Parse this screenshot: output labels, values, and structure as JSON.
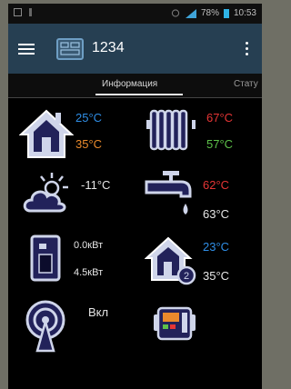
{
  "status_bar": {
    "battery": "78%",
    "time": "10:53"
  },
  "app_bar": {
    "title": "1234"
  },
  "tabs": [
    {
      "label": "Информация"
    },
    {
      "label": "Стату"
    }
  ],
  "tiles": {
    "home": {
      "temp_top": "25°C",
      "temp_bottom": "35°C"
    },
    "radiator": {
      "temp_top": "67°C",
      "temp_bottom": "57°C"
    },
    "weather": {
      "value": "-11°C"
    },
    "tap": {
      "temp_top": "62°C",
      "temp_bottom": "63°C"
    },
    "power": {
      "value_top": "0.0кВт",
      "value_bottom": "4.5кВт"
    },
    "home2": {
      "temp_top": "23°C",
      "temp_bottom": "35°C"
    },
    "antenna": {
      "value": "Вкл"
    }
  },
  "colors": {
    "blue": "#2f8ee6",
    "orange": "#e98a2c",
    "red": "#e53535",
    "green": "#5dc14a",
    "appbar": "#263f52",
    "icon": "#cfd5ea"
  }
}
